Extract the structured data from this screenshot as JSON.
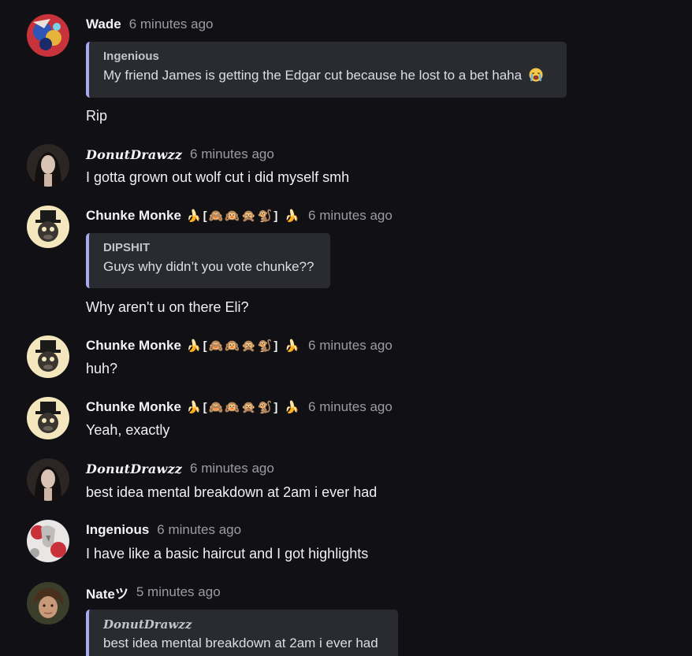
{
  "messages": [
    {
      "author": "Wade",
      "timestamp": "6 minutes ago",
      "reply": {
        "author": "Ingenious",
        "text": "My friend James is getting the Edgar cut because he lost to a bet haha",
        "emoji": "loudly-crying-face-emoji"
      },
      "text": "Rip"
    },
    {
      "author": "DonutDrawzz",
      "timestamp": "6 minutes ago",
      "text": "I gotta grown out wolf cut i did myself smh"
    },
    {
      "author": "Chunke Monke",
      "timestamp": "6 minutes ago",
      "reply": {
        "author": "DIPSHIT",
        "text": "Guys why didn’t you vote chunke??"
      },
      "text": "Why aren't u on there Eli?"
    },
    {
      "author": "Chunke Monke",
      "timestamp": "6 minutes ago",
      "text": "huh?"
    },
    {
      "author": "Chunke Monke",
      "timestamp": "6 minutes ago",
      "text": "Yeah, exactly"
    },
    {
      "author": "DonutDrawzz",
      "timestamp": "6 minutes ago",
      "text": "best idea mental breakdown at 2am i ever had"
    },
    {
      "author": "Ingenious",
      "timestamp": "6 minutes ago",
      "text": "I have like a basic haircut and I got highlights"
    },
    {
      "author": "Nateツ",
      "timestamp": "5 minutes ago",
      "reply": {
        "author": "DonutDrawzz",
        "text": "best idea mental breakdown at 2am i ever had"
      }
    }
  ],
  "chunke_badge": {
    "bracket_open": "[",
    "bracket_close": "]",
    "emojis": [
      "banana-emoji",
      "see-no-evil-monkey-emoji",
      "hear-no-evil-monkey-emoji",
      "speak-no-evil-monkey-emoji",
      "monkey-emoji",
      "banana-emoji"
    ]
  },
  "colors": {
    "background": "#111115",
    "quote_bg": "#2a2b30",
    "quote_border": "#a7a9f0",
    "timestamp": "#9a9ca3"
  }
}
